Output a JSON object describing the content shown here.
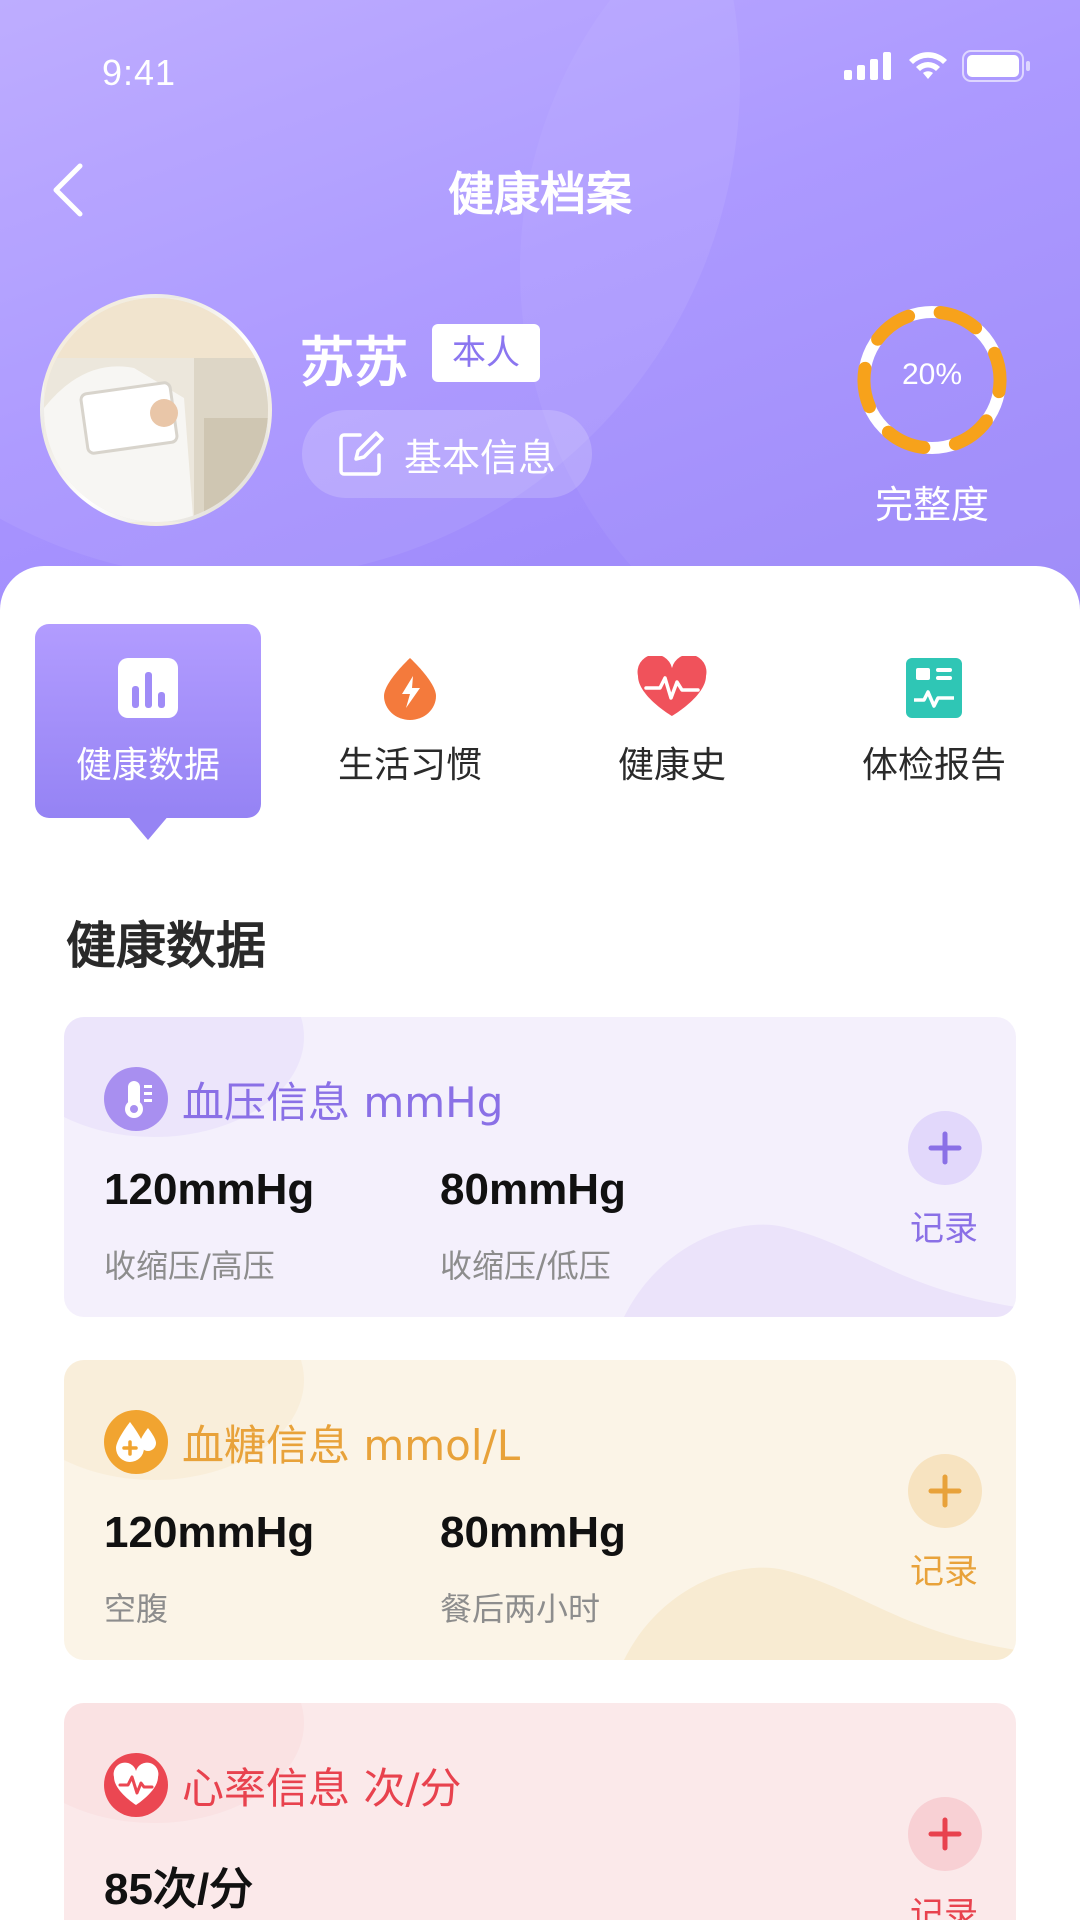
{
  "status_bar": {
    "time": "9:41"
  },
  "header": {
    "title": "健康档案"
  },
  "profile": {
    "name": "苏苏",
    "relation_tag": "本人",
    "basic_info_label": "基本信息",
    "completeness_percent_text": "20%",
    "completeness_value": 0.2,
    "completeness_label": "完整度"
  },
  "tabs": [
    {
      "label": "健康数据",
      "icon": "bar-chart-icon",
      "active": true
    },
    {
      "label": "生活习惯",
      "icon": "flame-icon",
      "active": false
    },
    {
      "label": "健康史",
      "icon": "heart-pulse-icon",
      "active": false
    },
    {
      "label": "体检报告",
      "icon": "report-icon",
      "active": false
    }
  ],
  "section": {
    "title": "健康数据"
  },
  "cards": {
    "blood_pressure": {
      "title": "血压信息 mmHg",
      "color": "#8a70e6",
      "values": [
        {
          "value": "120mmHg",
          "caption": "收缩压/高压"
        },
        {
          "value": "80mmHg",
          "caption": "收缩压/低压"
        }
      ],
      "record_label": "记录"
    },
    "blood_sugar": {
      "title": "血糖信息 mmol/L",
      "color": "#e8a23a",
      "values": [
        {
          "value": "120mmHg",
          "caption": "空腹"
        },
        {
          "value": "80mmHg",
          "caption": "餐后两小时"
        }
      ],
      "record_label": "记录"
    },
    "heart_rate": {
      "title": "心率信息 次/分",
      "color": "#e8424e",
      "values": [
        {
          "value": "85次/分",
          "caption": ""
        }
      ],
      "record_label": "记录"
    }
  }
}
